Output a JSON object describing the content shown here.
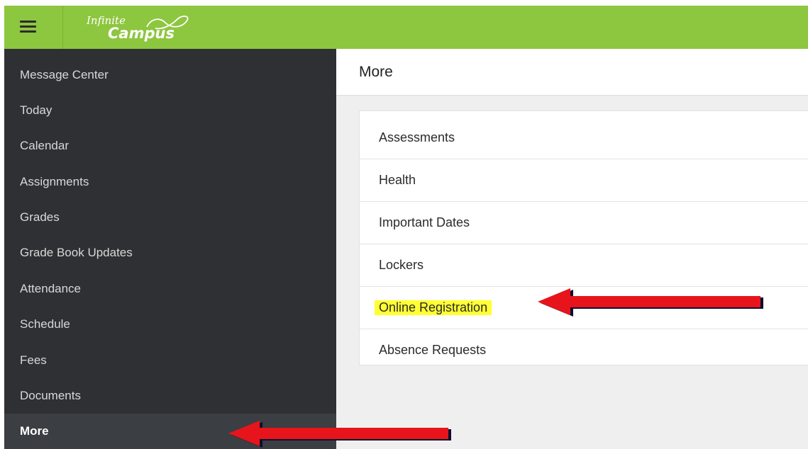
{
  "logo": {
    "line1": "Infinite",
    "line2": "Campus"
  },
  "sidebar": {
    "items": [
      {
        "label": "Message Center"
      },
      {
        "label": "Today"
      },
      {
        "label": "Calendar"
      },
      {
        "label": "Assignments"
      },
      {
        "label": "Grades"
      },
      {
        "label": "Grade Book Updates"
      },
      {
        "label": "Attendance"
      },
      {
        "label": "Schedule"
      },
      {
        "label": "Fees"
      },
      {
        "label": "Documents"
      },
      {
        "label": "More",
        "active": true
      }
    ]
  },
  "page": {
    "title": "More"
  },
  "more_list": {
    "items": [
      {
        "label": "Assessments"
      },
      {
        "label": "Health"
      },
      {
        "label": "Important Dates"
      },
      {
        "label": "Lockers"
      },
      {
        "label": "Online Registration",
        "highlighted": true
      },
      {
        "label": "Absence Requests"
      }
    ]
  },
  "colors": {
    "topbar": "#8dc63f",
    "sidebar": "#2e3033",
    "highlight": "#ffff33",
    "arrow": "#e8141b"
  },
  "icons": {
    "menu": "hamburger-icon",
    "logo": "infinity-swoosh-icon",
    "annotation": "left-arrow-icon"
  }
}
